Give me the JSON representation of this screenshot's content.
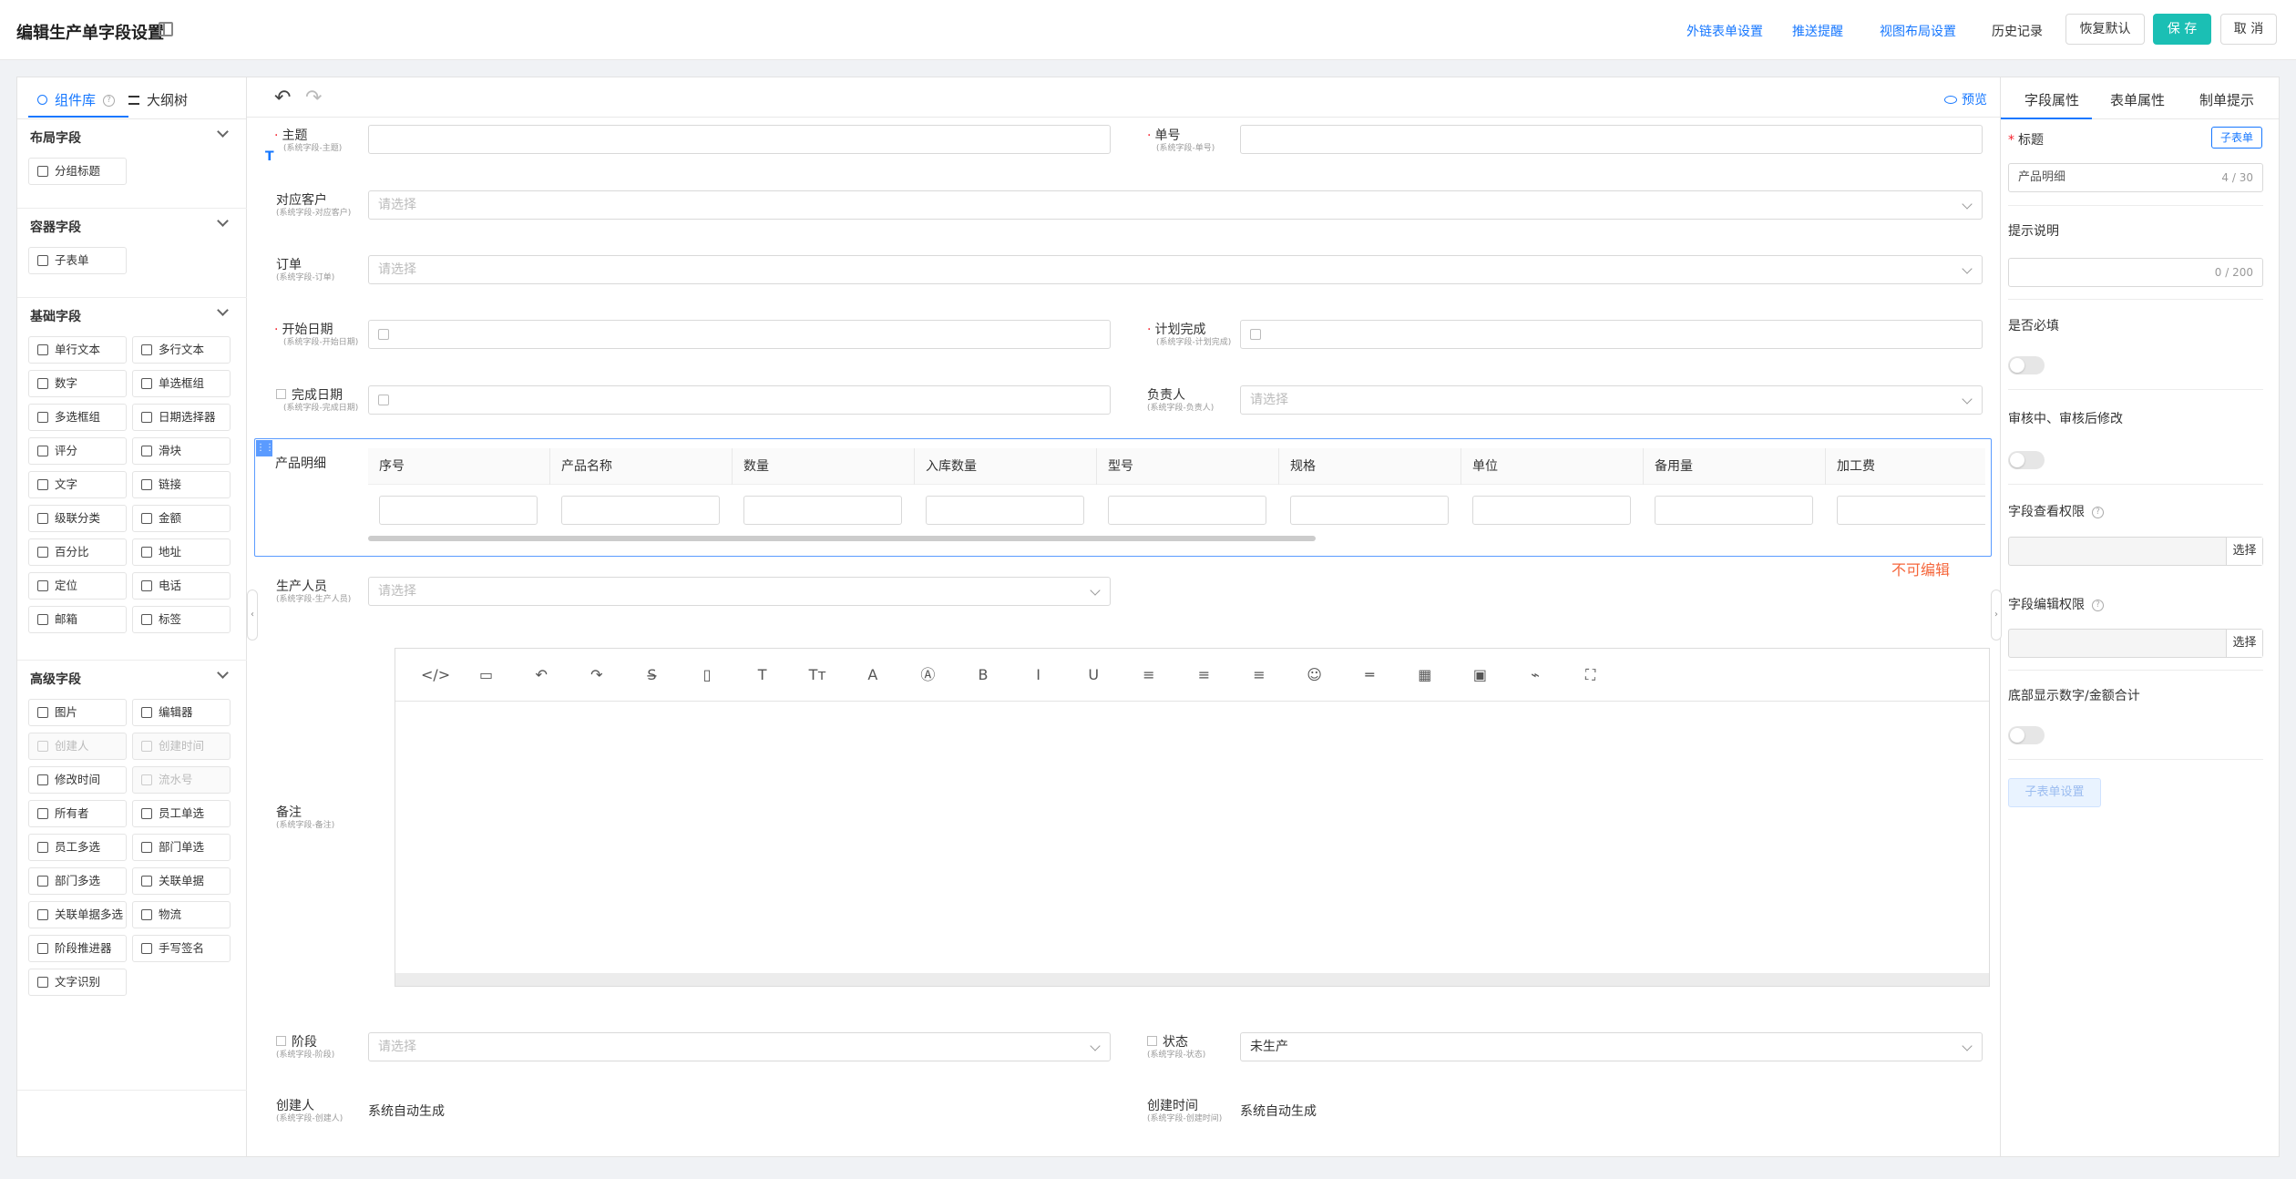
{
  "header": {
    "title": "编辑生产单字段设置",
    "links": [
      "外链表单设置",
      "推送提醒",
      "视图布局设置"
    ],
    "history": "历史记录",
    "restore": "恢复默认",
    "save": "保 存",
    "cancel": "取 消",
    "accent": "#1bbfb4"
  },
  "left": {
    "tab_components": "组件库",
    "tab_outline": "大纲树",
    "sections": [
      {
        "title": "布局字段",
        "items": [
          "分组标题"
        ]
      },
      {
        "title": "容器字段",
        "items": [
          "子表单"
        ]
      },
      {
        "title": "基础字段",
        "items": [
          "单行文本",
          "多行文本",
          "数字",
          "单选框组",
          "多选框组",
          "日期选择器",
          "评分",
          "滑块",
          "文字",
          "链接",
          "级联分类",
          "金额",
          "百分比",
          "地址",
          "定位",
          "电话",
          "邮箱",
          "标签"
        ]
      },
      {
        "title": "高级字段",
        "items": [
          "图片",
          "编辑器",
          "创建人",
          "创建时间",
          "修改时间",
          "流水号",
          "所有者",
          "员工单选",
          "员工多选",
          "部门单选",
          "部门多选",
          "关联单据",
          "关联单据多选",
          "物流",
          "阶段推进器",
          "手写签名",
          "文字识别"
        ]
      }
    ]
  },
  "canvas": {
    "preview": "预览",
    "placeholder": "请选择",
    "fields": {
      "subject": {
        "label": "主题",
        "sub": "(系统字段-主题)"
      },
      "number": {
        "label": "单号",
        "sub": "(系统字段-单号)"
      },
      "customer": {
        "label": "对应客户",
        "sub": "(系统字段-对应客户)"
      },
      "order": {
        "label": "订单",
        "sub": "(系统字段-订单)"
      },
      "start": {
        "label": "开始日期",
        "sub": "(系统字段-开始日期)"
      },
      "plan": {
        "label": "计划完成",
        "sub": "(系统字段-计划完成)"
      },
      "done": {
        "label": "完成日期",
        "sub": "(系统字段-完成日期)"
      },
      "owner": {
        "label": "负责人",
        "sub": "(系统字段-负责人)"
      },
      "worker": {
        "label": "生产人员",
        "sub": "(系统字段-生产人员)"
      },
      "note": {
        "label": "备注",
        "sub": "(系统字段-备注)"
      },
      "stage": {
        "label": "阶段",
        "sub": "(系统字段-阶段)"
      },
      "status": {
        "label": "状态",
        "sub": "(系统字段-状态)",
        "value": "未生产"
      },
      "creator": {
        "label": "创建人",
        "sub": "(系统字段-创建人)",
        "value": "系统自动生成"
      },
      "created": {
        "label": "创建时间",
        "sub": "(系统字段-创建时间)",
        "value": "系统自动生成"
      }
    },
    "subtable": {
      "label": "产品明细",
      "columns": [
        "序号",
        "产品名称",
        "数量",
        "入库数量",
        "型号",
        "规格",
        "单位",
        "备用量",
        "加工费"
      ],
      "badge": "不可编辑"
    }
  },
  "right": {
    "tabs": [
      "字段属性",
      "表单属性",
      "制单提示"
    ],
    "title_label": "标题",
    "type_tag": "子表单",
    "title_value": "产品明细",
    "title_count": "4 / 30",
    "hint_label": "提示说明",
    "hint_count": "0 / 200",
    "required_label": "是否必填",
    "audit_label": "审核中、审核后修改",
    "view_perm": "字段查看权限",
    "edit_perm": "字段编辑权限",
    "select": "选择",
    "sum_label": "底部显示数字/金额合计",
    "sub_settings": "子表单设置"
  }
}
